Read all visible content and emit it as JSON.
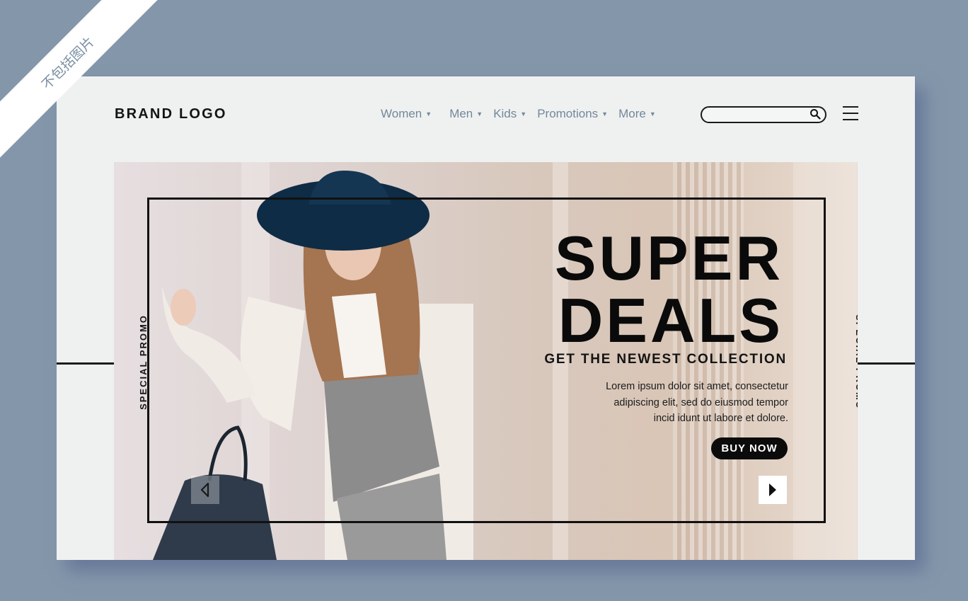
{
  "watermark": "不包括图片",
  "header": {
    "logo": "BRAND LOGO",
    "nav": [
      {
        "label": "Women"
      },
      {
        "label": "Men"
      },
      {
        "label": "Kids"
      },
      {
        "label": "Promotions"
      },
      {
        "label": "More"
      }
    ],
    "search": {
      "placeholder": "",
      "value": ""
    }
  },
  "hero": {
    "side_label": "SPECIAL PROMO",
    "headline_line1": "SUPER",
    "headline_line2": "DEALS",
    "subheadline": "GET THE NEWEST COLLECTION",
    "body_line1": "Lorem ipsum dolor sit amet, consectetur",
    "body_line2": "adipiscing elit, sed do eiusmod tempor",
    "body_line3": "incid idunt ut labore et dolore.",
    "cta": "BUY NOW"
  },
  "colors": {
    "page_bg": "#8497aa",
    "card_bg": "#eff1f1",
    "nav_text": "#74879a",
    "text_dark": "#141414",
    "button_bg": "#0b0b0b"
  },
  "icons": [
    "search-icon",
    "hamburger-menu-icon",
    "caret-down-icon",
    "arrow-left-icon",
    "arrow-right-icon"
  ]
}
